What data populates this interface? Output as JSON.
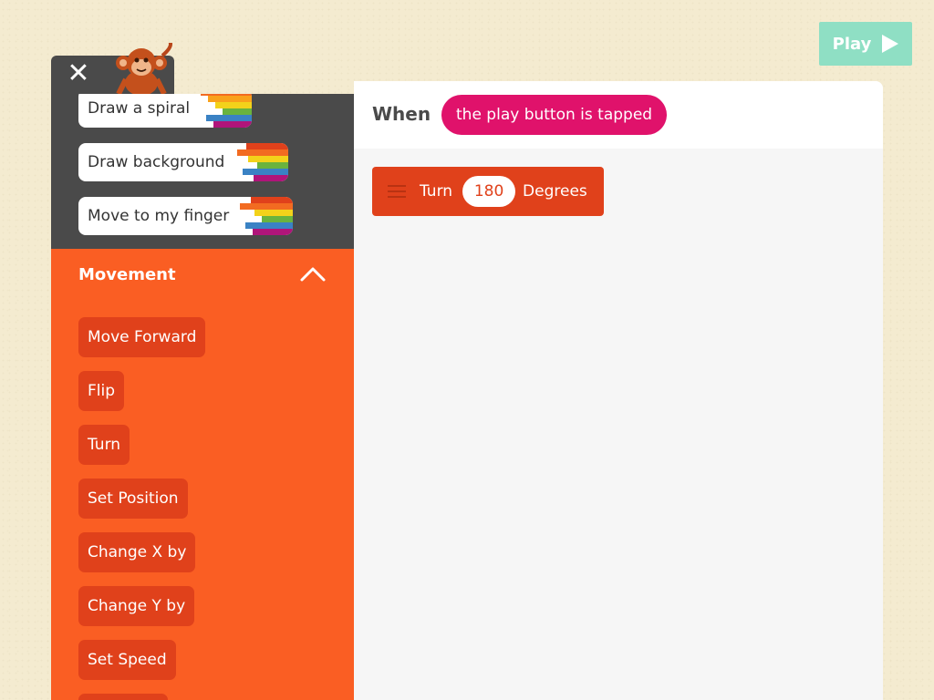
{
  "header": {
    "play_label": "Play"
  },
  "palette": {
    "functions": [
      {
        "label": "Draw a spiral"
      },
      {
        "label": "Draw background"
      },
      {
        "label": "Move to my finger"
      }
    ],
    "movement": {
      "title": "Movement",
      "blocks": [
        "Move Forward",
        "Flip",
        "Turn",
        "Set Position",
        "Change X by",
        "Change Y by",
        "Set Speed"
      ]
    }
  },
  "editor": {
    "when_label": "When",
    "trigger": "the play button is tapped",
    "block": {
      "label": "Turn",
      "value": "180",
      "unit": "Degrees"
    }
  },
  "colors": {
    "movement": "#fa5e23",
    "block": "#e0411b",
    "trigger": "#e0126b",
    "play": "#8fdfc4",
    "dark": "#4a4a4a"
  },
  "icons": [
    "close-icon",
    "play-icon",
    "chevron-up-icon",
    "drag-handle-icon",
    "monkey-character-icon"
  ]
}
